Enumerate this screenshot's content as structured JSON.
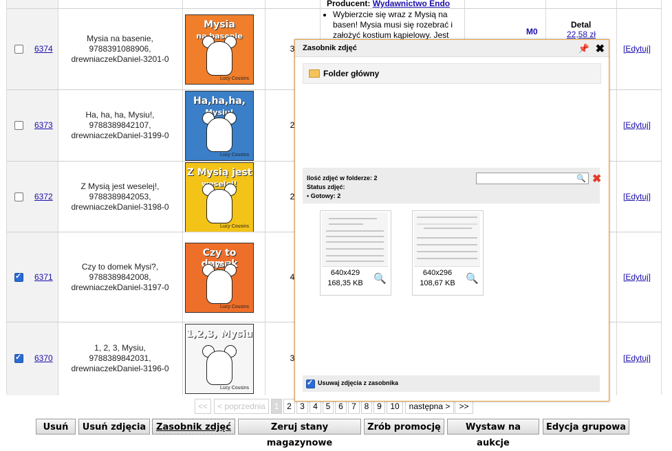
{
  "rows": [
    {
      "id": "6374",
      "name": [
        "Mysia na basenie,",
        "9788391088906,",
        "drewniaczekDaniel-3201-0"
      ],
      "qty": "3",
      "checked": false,
      "cover": {
        "title": "Mysia",
        "sub": "na basenie",
        "bg": "#f07e2a",
        "author": "Lucy Cousins"
      }
    },
    {
      "id": "6373",
      "name": [
        "Ha, ha, ha, Mysiu!,",
        "9788389842107,",
        "drewniaczekDaniel-3199-0"
      ],
      "qty": "2",
      "checked": false,
      "cover": {
        "title": "Ha,ha,ha,",
        "sub": "Mysiu!",
        "bg": "#3a7fc8",
        "author": "Lucy Cousins"
      }
    },
    {
      "id": "6372",
      "name": [
        "Z Mysią jest weselej!,",
        "9788389842053,",
        "drewniaczekDaniel-3198-0"
      ],
      "qty": "2",
      "checked": false,
      "cover": {
        "title": "Z Mysią jest",
        "sub": "weselej!",
        "bg": "#f3c318",
        "author": "Lucy Cousins"
      }
    },
    {
      "id": "6371",
      "name": [
        "Czy to domek Mysi?,",
        "9788389842008,",
        "drewniaczekDaniel-3197-0"
      ],
      "qty": "4",
      "checked": true,
      "cover": {
        "title": "Czy to domek",
        "sub": "Mysi?",
        "bg": "#ee6f2a",
        "author": "Lucy Cousins"
      }
    },
    {
      "id": "6370",
      "name": [
        "1, 2, 3, Mysiu,",
        "9788389842031,",
        "drewniaczekDaniel-3196-0"
      ],
      "qty": "3",
      "checked": true,
      "cover": {
        "title": "1,2,3, Mysiu",
        "sub": "",
        "bg": "#f6f6f6",
        "author": "Lucy Cousins"
      }
    }
  ],
  "edit_label": "[Edytuj]",
  "top_desc": {
    "producer_label": "Producent:",
    "producer": "Wydawnictwo Endo",
    "bullet": "Wybierzcie się wraz z Mysią na basen! Mysia musi się rozebrać i założyć kostium kąpielowy. Jest"
  },
  "detail": {
    "m0": "M0",
    "detal": "Detal",
    "price": "22,58 zł"
  },
  "pager": {
    "first": "<<",
    "prev": "< poprzednia",
    "pages": [
      "1",
      "2",
      "3",
      "4",
      "5",
      "6",
      "7",
      "8",
      "9",
      "10"
    ],
    "next": "następna >",
    "last": ">>"
  },
  "buttons": [
    "Usuń",
    "Usuń zdjęcia",
    "Zasobnik zdjęć",
    "Zeruj stany magazynowe",
    "Zrób promocję",
    "Wystaw na aukcje",
    "Edycja grupowa"
  ],
  "modal": {
    "title": "Zasobnik zdjęć",
    "folder": "Folder główny",
    "count_label": "Ilość zdjęć w folderze: 2",
    "status_label": "Status zdjęć:",
    "ready_label": "Gotowy: 2",
    "search_placeholder": "",
    "thumbs": [
      {
        "dim": "640x429",
        "size": "168,35 KB"
      },
      {
        "dim": "640x296",
        "size": "108,67 KB"
      }
    ],
    "footer_label": "Usuwaj zdjęcia z zasobnika"
  }
}
